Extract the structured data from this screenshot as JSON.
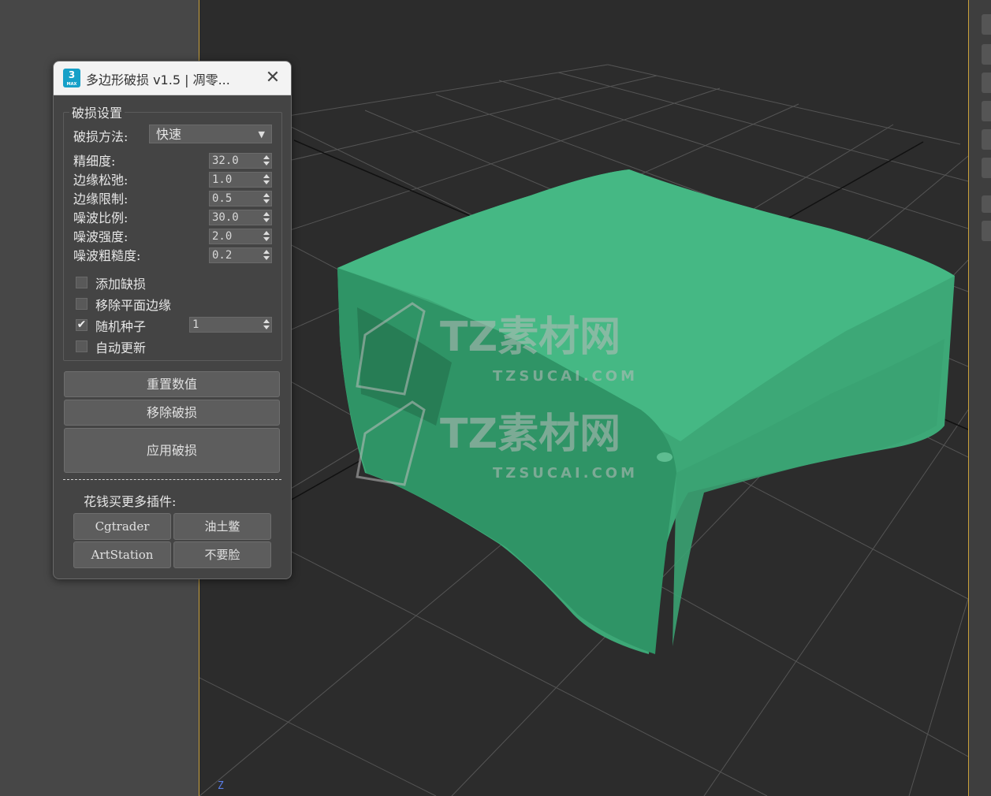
{
  "dialog": {
    "title": "多边形破损 v1.5 | 凋零...",
    "app_icon_label": "3",
    "app_icon_sub": "MAX",
    "close_glyph": "✕"
  },
  "settings": {
    "group_title": "破损设置",
    "method": {
      "label": "破损方法:",
      "value": "快速"
    },
    "params": [
      {
        "label": "精细度:",
        "value": "32.0"
      },
      {
        "label": "边缘松弛:",
        "value": "1.0"
      },
      {
        "label": "边缘限制:",
        "value": "0.5"
      },
      {
        "label": "噪波比例:",
        "value": "30.0"
      },
      {
        "label": "噪波强度:",
        "value": "2.0"
      },
      {
        "label": "噪波粗糙度:",
        "value": "0.2"
      }
    ],
    "checkboxes": [
      {
        "label": "添加缺损",
        "checked": false
      },
      {
        "label": "移除平面边缘",
        "checked": false
      },
      {
        "label": "随机种子",
        "checked": true
      },
      {
        "label": "自动更新",
        "checked": false
      }
    ],
    "seed_value": "1",
    "check_glyph": "✔"
  },
  "actions": {
    "reset": "重置数值",
    "remove": "移除破损",
    "apply": "应用破损"
  },
  "promo": {
    "label": "花钱买更多插件:",
    "links": [
      "Cgtrader",
      "油土鳖",
      "ArtStation",
      "不要脸"
    ]
  },
  "viewport": {
    "axis_label": "Z",
    "object_color": "#3fb07f",
    "watermark_text": "TZ素材网",
    "watermark_url": "TZSUCAI.COM"
  }
}
